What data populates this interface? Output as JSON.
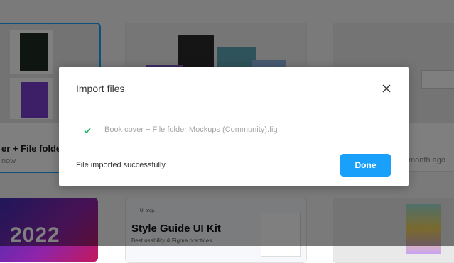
{
  "background": {
    "card1": {
      "title": "er + File folde",
      "meta": "now"
    },
    "card3": {
      "meta": "month ago"
    },
    "card4": {
      "text": "2022"
    },
    "card5": {
      "brand": "UI prep.",
      "title": "Style Guide UI Kit",
      "subtitle": "Best usability & Figma practices"
    }
  },
  "modal": {
    "title": "Import files",
    "files": [
      {
        "name": "Book cover + File folder Mockups (Community).fig",
        "status_icon": "check-icon"
      }
    ],
    "status_text": "File imported successfully",
    "done_label": "Done",
    "close_icon": "close-icon"
  },
  "colors": {
    "accent": "#18a0fb",
    "success": "#14ae5c",
    "overlay": "rgba(0,0,0,0.5)"
  }
}
